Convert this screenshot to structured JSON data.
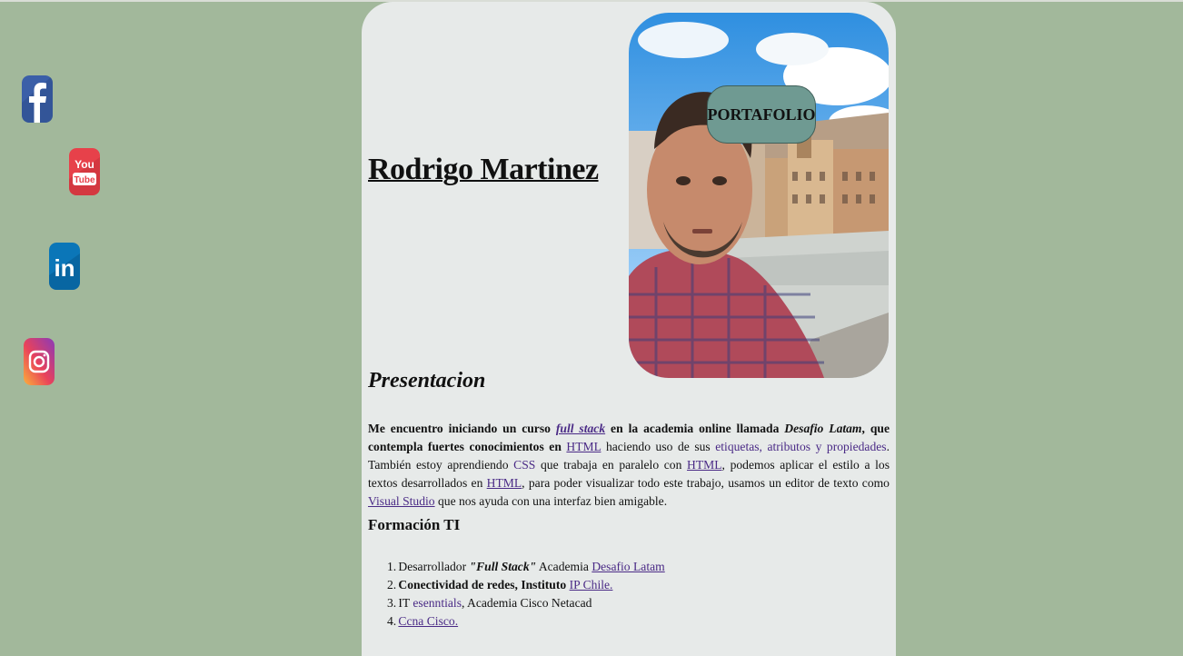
{
  "social": {
    "facebook_icon": "facebook-icon",
    "youtube_icon": "youtube-icon",
    "youtube_text_top": "You",
    "youtube_text_bottom": "Tube",
    "linkedin_icon": "linkedin-icon",
    "linkedin_text": "in",
    "instagram_icon": "instagram-icon"
  },
  "header": {
    "name": "Rodrigo Martinez",
    "badge": "PORTAFOLIO"
  },
  "presentation": {
    "title": "Presentacion",
    "p1": "Me encuentro iniciando un curso ",
    "link_fullstack": "full stack",
    "p2": " en la academia online llamada ",
    "desafio": "Desafio Latam",
    "p3": ", que contempla fuertes conocimientos en ",
    "link_html1": "HTML",
    "p4": " haciendo uso de sus ",
    "kw_etiquetas": "etiquetas, atributos y propiedades",
    "p5": ". También estoy aprendiendo ",
    "kw_css": "CSS",
    "p6": " que trabaja en paralelo con ",
    "link_html2": "HTML",
    "p7": ", podemos aplicar el estilo a los textos desarrollados en ",
    "link_html3": "HTML",
    "p8": ", para poder visualizar todo este trabajo, usamos un editor de texto como ",
    "link_vscode": "Visual Studio",
    "p9": " que nos ayuda con una interfaz bien amigable."
  },
  "formacion": {
    "title": "Formación TI",
    "items": [
      {
        "num": "1.",
        "pre": " Desarrollador ",
        "em": "\"Full Stack\"",
        "mid": " Academia ",
        "link": "Desafio Latam",
        "post": ""
      },
      {
        "num": "2.",
        "pre": " Conectividad de redes, Instituto ",
        "em": "",
        "mid": "",
        "link": "IP Chile.",
        "post": ""
      },
      {
        "num": "3.",
        "pre": " IT ",
        "em": "",
        "mid": "",
        "link": "esenntials",
        "post": ", Academia Cisco Netacad"
      },
      {
        "num": "4.",
        "pre": " ",
        "em": "",
        "mid": "",
        "link": "Ccna Cisco.",
        "post": ""
      }
    ]
  },
  "colors": {
    "background": "#a2b89b",
    "panel": "#e7eae9",
    "badge": "#6f9a92",
    "link": "#4a2a86"
  }
}
